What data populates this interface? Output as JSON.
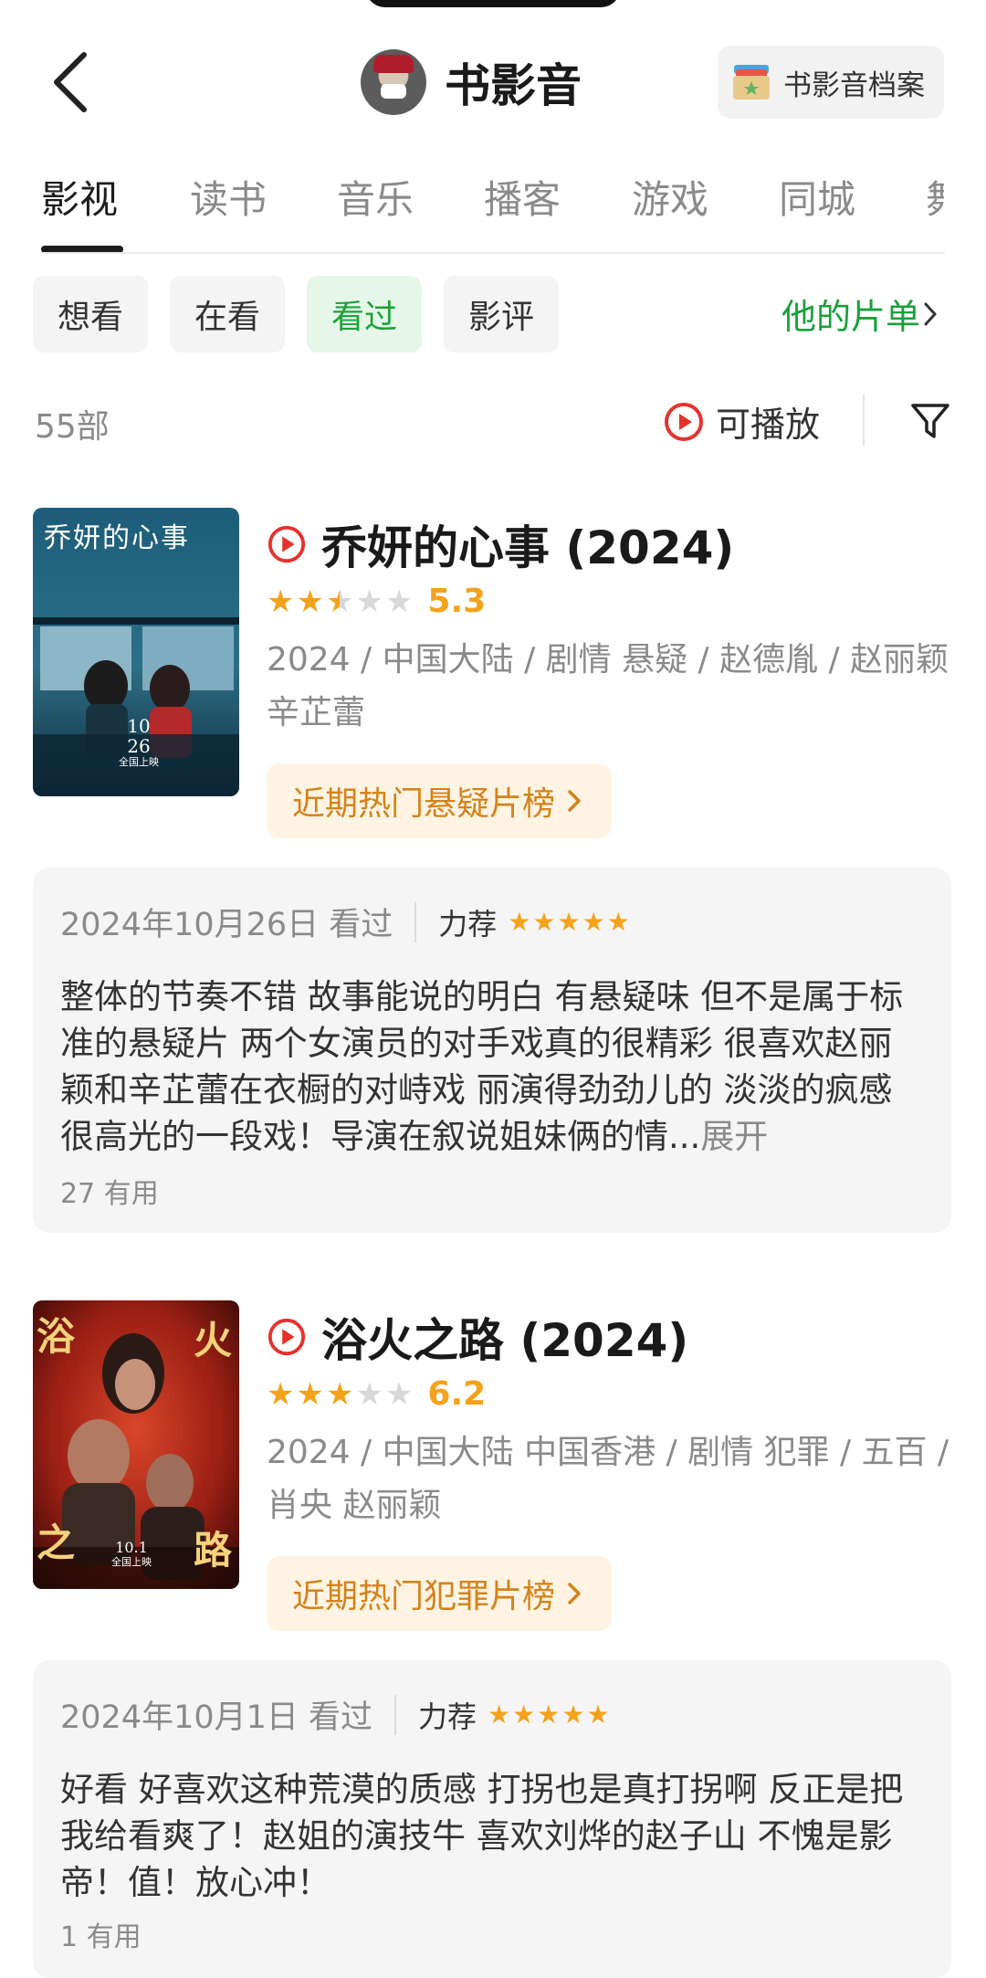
{
  "header": {
    "title": "书影音",
    "archive_label": "书影音档案"
  },
  "tabs": [
    {
      "label": "影视",
      "active": true
    },
    {
      "label": "读书"
    },
    {
      "label": "音乐"
    },
    {
      "label": "播客"
    },
    {
      "label": "游戏"
    },
    {
      "label": "同城"
    },
    {
      "label": "舞"
    }
  ],
  "filters": [
    {
      "label": "想看"
    },
    {
      "label": "在看"
    },
    {
      "label": "看过",
      "active": true
    },
    {
      "label": "影评"
    }
  ],
  "doulist_label": "他的片单",
  "count_label": "55部",
  "playable_label": "可播放",
  "colors": {
    "accent_green": "#19a03a",
    "star_orange": "#f4a21b",
    "play_red": "#e5322d",
    "rank_bg": "#fff4e3",
    "rank_text": "#d4821b"
  },
  "movies": [
    {
      "title": "乔妍的心事 (2024)",
      "rating": 2.5,
      "score": "5.3",
      "meta": "2024 / 中国大陆 / 剧情 悬疑 / 赵德胤 / 赵丽颖 辛芷蕾",
      "rank_label": "近期热门悬疑片榜",
      "poster": {
        "title": "乔妍的心事",
        "date_line1": "10",
        "date_line2": "26",
        "date_line3": "全国上映"
      },
      "review": {
        "date": "2024年10月26日 看过",
        "recommend": "力荐",
        "stars": 5,
        "text": "整体的节奏不错 故事能说的明白 有悬疑味 但不是属于标准的悬疑片 两个女演员的对手戏真的很精彩 很喜欢赵丽颖和辛芷蕾在衣橱的对峙戏  丽演得劲劲儿的 淡淡的疯感 很高光的一段戏！导演在叙说姐妹俩的情...",
        "expand": "展开",
        "useful": "27 有用"
      }
    },
    {
      "title": "浴火之路 (2024)",
      "rating": 3,
      "score": "6.2",
      "meta": "2024 / 中国大陆 中国香港 / 剧情 犯罪 / 五百 / 肖央 赵丽颖",
      "rank_label": "近期热门犯罪片榜",
      "poster": {
        "char_tl": "浴",
        "char_tr": "火",
        "char_bl": "之",
        "char_br": "路",
        "date_line": "10.1",
        "date_line2": "全国上映"
      },
      "review": {
        "date": "2024年10月1日 看过",
        "recommend": "力荐",
        "stars": 5,
        "text": "好看 好喜欢这种荒漠的质感 打拐也是真打拐啊 反正是把我给看爽了！赵姐的演技牛 喜欢刘烨的赵子山 不愧是影帝！值！放心冲！",
        "useful": "1 有用"
      }
    }
  ]
}
